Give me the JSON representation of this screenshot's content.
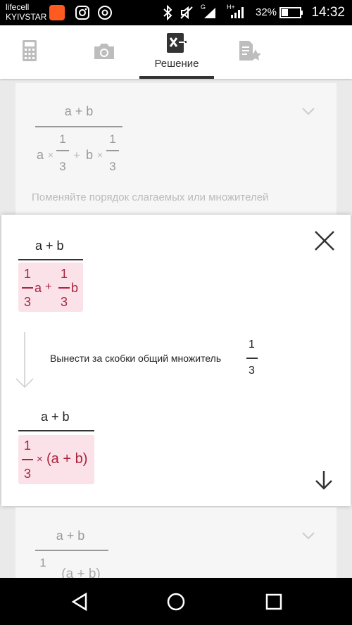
{
  "status": {
    "carrier_line1": "lifecell",
    "carrier_line2": "KYIVSTAR",
    "battery": "32%",
    "time": "14:32",
    "signal1_label": "G",
    "signal2_label": "H+"
  },
  "tabs": {
    "calculator_icon": "calculator-icon",
    "camera_icon": "camera-icon",
    "solution_label": "Решение",
    "favorites_icon": "favorites-icon"
  },
  "background_card": {
    "numerator": "a + b",
    "den_a": "a",
    "den_times": "×",
    "den_one": "1",
    "den_three": "3",
    "den_plus": "+",
    "den_b": "b",
    "hint": "Поменяйте порядок слагаемых или множителей"
  },
  "overlay": {
    "step1_numerator": "a + b",
    "step1_one": "1",
    "step1_three": "3",
    "step1_a": "a",
    "step1_plus": "+",
    "step1_b": "b",
    "step_description": "Вынести за скобки общий множитель",
    "step_factor_num": "1",
    "step_factor_den": "3",
    "step2_numerator": "a + b",
    "step2_one": "1",
    "step2_three": "3",
    "step2_times": "×",
    "step2_paren": "(a + b)"
  },
  "bottom_card": {
    "numerator": "a + b",
    "den_partial": "1",
    "den_tail": "(a + b)"
  }
}
